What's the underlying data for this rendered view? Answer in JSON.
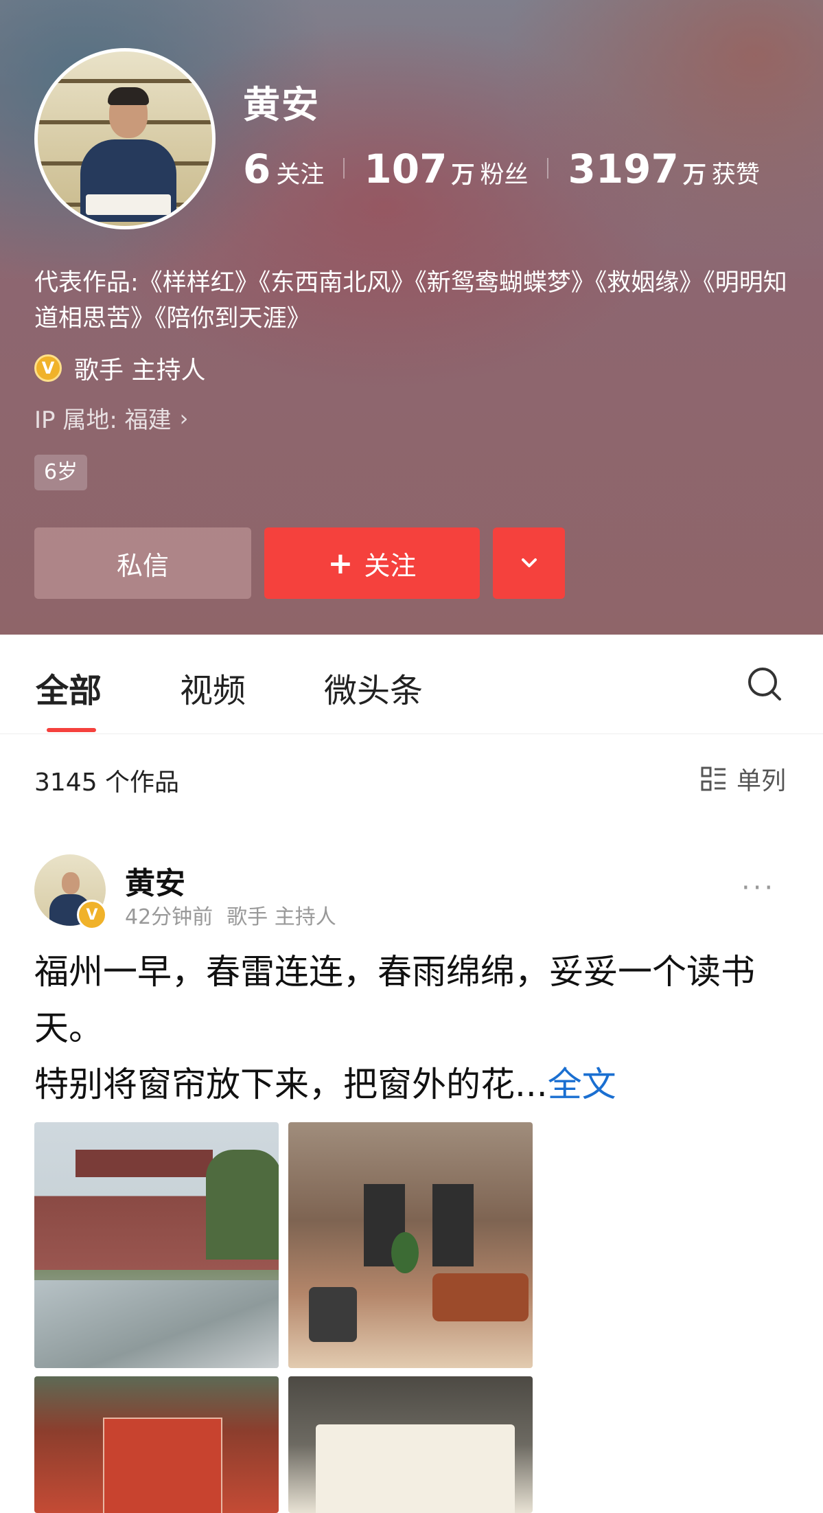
{
  "profile": {
    "name": "黄安",
    "stats": [
      {
        "number": "6",
        "unit": "",
        "label": "关注"
      },
      {
        "number": "107",
        "unit": "万",
        "label": "粉丝"
      },
      {
        "number": "3197",
        "unit": "万",
        "label": "获赞"
      }
    ],
    "bio": "代表作品:《样样红》《东西南北风》《新鸳鸯蝴蝶梦》《救姻缘》《明明知道相思苦》《陪你到天涯》",
    "verification": "歌手 主持人",
    "ip_location": "IP 属地: 福建",
    "age_tag": "6岁",
    "buttons": {
      "message": "私信",
      "follow": "关注"
    }
  },
  "tabs": [
    {
      "label": "全部",
      "active": true
    },
    {
      "label": "视频",
      "active": false
    },
    {
      "label": "微头条",
      "active": false
    }
  ],
  "works_count": "3145 个作品",
  "layout_toggle": "单列",
  "post": {
    "author": "黄安",
    "time": "42分钟前",
    "tag": "歌手 主持人",
    "more": "···",
    "text_line1": "福州一早，春雷连连，春雨绵绵，妥妥一个读书天。",
    "text_line2": "特别将窗帘放下来，把窗外的花...",
    "full_link": "全文"
  },
  "colors": {
    "accent_red": "#f5413d",
    "link_blue": "#1a6fd1",
    "verify_gold": "#f0b22a"
  }
}
